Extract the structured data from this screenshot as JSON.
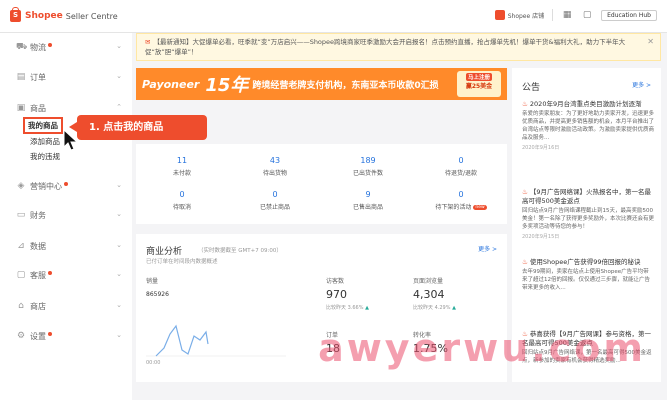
{
  "topbar": {
    "logo_title": "Shopee",
    "logo_subtitle": "Seller Centre",
    "shop_name": "Shopee 店铺",
    "edu_label": "Education Hub"
  },
  "sidebar": {
    "items": [
      {
        "label": "物流",
        "icon": "truck-icon",
        "dot": true
      },
      {
        "label": "订单",
        "icon": "order-icon",
        "dot": false
      },
      {
        "label": "商品",
        "icon": "bag-icon",
        "dot": false
      },
      {
        "label": "营销中心",
        "icon": "tag-icon",
        "dot": true
      },
      {
        "label": "财务",
        "icon": "wallet-icon",
        "dot": false
      },
      {
        "label": "数据",
        "icon": "chart-icon",
        "dot": false
      },
      {
        "label": "客服",
        "icon": "chat-icon",
        "dot": true
      },
      {
        "label": "商店",
        "icon": "shop-icon",
        "dot": false
      },
      {
        "label": "设置",
        "icon": "gear-icon",
        "dot": true
      }
    ],
    "product_sub": [
      "我的商品",
      "添加商品",
      "我的违规"
    ]
  },
  "callout": {
    "label": "1. 点击我的商品"
  },
  "notice": {
    "text": "【最新通知】大促爆单必看，旺季就“变”万店启兴——Shopee跨境商家旺季激励大会开启报名！点击预约直播，抢占爆单先机！爆单干货&福利大礼，助力下半年大促“放”胆“爆单”！"
  },
  "banner": {
    "brand": "Payoneer",
    "big": "15年",
    "text": "跨境经营老牌支付机构，东南亚本币收款0汇损",
    "badge_line1": "马上注册",
    "badge_line2": "赢25美金"
  },
  "todo": [
    {
      "num": "11",
      "label": "未付款"
    },
    {
      "num": "43",
      "label": "待出货物"
    },
    {
      "num": "189",
      "label": "已出货件数"
    },
    {
      "num": "0",
      "label": "待退货/退款"
    },
    {
      "num": "0",
      "label": "待取消"
    },
    {
      "num": "0",
      "label": "已禁止商品"
    },
    {
      "num": "9",
      "label": "已售出商品"
    },
    {
      "num": "0",
      "label": "待下架的活动"
    }
  ],
  "todo_new_badge": "new",
  "business": {
    "title": "商业分析",
    "subtitle": "（实时数据截至 GMT+7 09:00）",
    "note": "已付订单在时间段内数据概述",
    "more": "更多 >",
    "chart_label": "销量",
    "chart_value": "865926",
    "chart_x0": "00:00",
    "metrics": [
      {
        "label": "访客数",
        "value": "970",
        "cmp": "比较昨天",
        "change": "3.66%"
      },
      {
        "label": "页面浏览量",
        "value": "4,304",
        "cmp": "比较昨天",
        "change": "4.29%"
      },
      {
        "label": "订单",
        "value": "18",
        "cmp": "",
        "change": ""
      },
      {
        "label": "转化率",
        "value": "1.75%",
        "cmp": "",
        "change": ""
      }
    ]
  },
  "announce": {
    "title": "公告",
    "more": "更多 >",
    "items": [
      {
        "title": "2020年9月台湾重点类目激励计划逐渐",
        "body": "亲爱的卖家朋友：为了更好地助力卖家开发，迅速更多优质商品，并提高更多销售额的机会，本月平台推出了台湾站点等限时激励活动政策。为激励卖家提供优质商品及服务...",
        "date": "2020年9月16日"
      },
      {
        "title": "【9月广告网络课】火热报名中，第一名最高可得500美金返点",
        "body": "回归站点9月广告网络课程截止到15天，最高奖励500美金！第一名除了获得更多奖励外，本次比赛还会有更多奖项活动等待您的参与！",
        "date": "2020年9月15日"
      },
      {
        "title": "使用Shopee广告获得99倍回报的秘诀",
        "body": "去年99期间，卖家在站点上使用Shopee广告平均带来了超过12倍的回报。仅仅通过三步骤，就能让广告带来更多的收入...",
        "date": ""
      },
      {
        "title": "恭喜获得【9月广告网课】参与资格，第一名最高可得500美金返点",
        "body": "回归站点9月广告网络课，第一名最高可得500美金返点，新参加的卖家有机会获得精选奖励...",
        "date": ""
      }
    ]
  },
  "watermark": "awyerwu.com"
}
